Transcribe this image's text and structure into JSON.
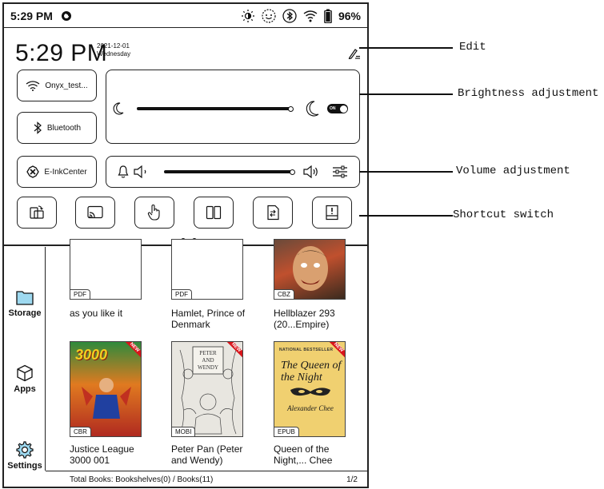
{
  "status_bar": {
    "time": "5:29 PM",
    "battery": "96%"
  },
  "quick_panel": {
    "clock": "5:29 PM",
    "date": "2021-12-01",
    "weekday": "Wednesday",
    "tiles": {
      "wifi": "Onyx_test...",
      "bluetooth": "Bluetooth",
      "eink": "E-InkCenter"
    },
    "brightness_toggle": "ON",
    "brightness_level": 1.0,
    "volume_level": 1.0,
    "page_indicator": {
      "current": 1,
      "total": 2
    }
  },
  "sidebar": [
    {
      "label": "Storage",
      "icon": "folder-icon"
    },
    {
      "label": "Apps",
      "icon": "cube-icon"
    },
    {
      "label": "Settings",
      "icon": "gear-icon"
    }
  ],
  "books": [
    {
      "title": "as you like it",
      "format": "PDF"
    },
    {
      "title": "Hamlet, Prince of Denmark",
      "format": "PDF"
    },
    {
      "title": "Hellblazer 293 (20...Empire)",
      "format": "CBZ"
    },
    {
      "title": "Justice League 3000 001",
      "format": "CBR",
      "cover_text": "3000",
      "badge": "NEW"
    },
    {
      "title": "Peter Pan (Peter and Wendy)",
      "format": "MOBI",
      "cover_text": "PETER AND WENDY",
      "badge": "NEW"
    },
    {
      "title": "Queen of the Night,... Chee",
      "format": "EPUB",
      "cover_text": "The Queen of the Night",
      "cover_author": "Alexander Chee",
      "cover_tag": "NATIONAL BESTSELLER",
      "badge": "NEW"
    }
  ],
  "footer": {
    "total": "Total Books: Bookshelves(0) / Books(11)",
    "page": "1/2"
  },
  "callouts": {
    "edit": "Edit",
    "brightness": "Brightness adjustment",
    "volume": "Volume adjustment",
    "shortcut": "Shortcut switch"
  }
}
